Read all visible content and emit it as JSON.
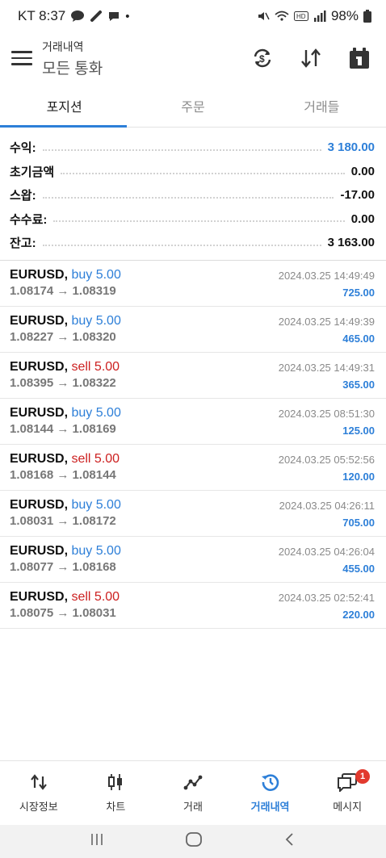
{
  "status_bar": {
    "carrier_time": "KT 8:37",
    "battery": "98%"
  },
  "header": {
    "title": "거래내역",
    "subtitle": "모든 통화"
  },
  "tabs": [
    {
      "label": "포지션",
      "active": true
    },
    {
      "label": "주문",
      "active": false
    },
    {
      "label": "거래들",
      "active": false
    }
  ],
  "summary": [
    {
      "label": "수익:",
      "value": "3 180.00"
    },
    {
      "label": "초기금액",
      "value": "0.00"
    },
    {
      "label": "스왑:",
      "value": "-17.00"
    },
    {
      "label": "수수료:",
      "value": "0.00"
    },
    {
      "label": "잔고:",
      "value": "3 163.00"
    }
  ],
  "trades": [
    {
      "symbol": "EURUSD,",
      "side": "buy 5.00",
      "type": "buy",
      "prices": "1.08174 → 1.08319",
      "time": "2024.03.25 14:49:49",
      "profit": "725.00"
    },
    {
      "symbol": "EURUSD,",
      "side": "buy 5.00",
      "type": "buy",
      "prices": "1.08227 → 1.08320",
      "time": "2024.03.25 14:49:39",
      "profit": "465.00"
    },
    {
      "symbol": "EURUSD,",
      "side": "sell 5.00",
      "type": "sell",
      "prices": "1.08395 → 1.08322",
      "time": "2024.03.25 14:49:31",
      "profit": "365.00"
    },
    {
      "symbol": "EURUSD,",
      "side": "buy 5.00",
      "type": "buy",
      "prices": "1.08144 → 1.08169",
      "time": "2024.03.25 08:51:30",
      "profit": "125.00"
    },
    {
      "symbol": "EURUSD,",
      "side": "sell 5.00",
      "type": "sell",
      "prices": "1.08168 → 1.08144",
      "time": "2024.03.25 05:52:56",
      "profit": "120.00"
    },
    {
      "symbol": "EURUSD,",
      "side": "buy 5.00",
      "type": "buy",
      "prices": "1.08031 → 1.08172",
      "time": "2024.03.25 04:26:11",
      "profit": "705.00"
    },
    {
      "symbol": "EURUSD,",
      "side": "buy 5.00",
      "type": "buy",
      "prices": "1.08077 → 1.08168",
      "time": "2024.03.25 04:26:04",
      "profit": "455.00"
    },
    {
      "symbol": "EURUSD,",
      "side": "sell 5.00",
      "type": "sell",
      "prices": "1.08075 → 1.08031",
      "time": "2024.03.25 02:52:41",
      "profit": "220.00"
    }
  ],
  "bottom_nav": [
    {
      "label": "시장정보",
      "icon": "quotes-icon",
      "active": false
    },
    {
      "label": "차트",
      "icon": "candlestick-icon",
      "active": false
    },
    {
      "label": "거래",
      "icon": "trade-line-icon",
      "active": false
    },
    {
      "label": "거래내역",
      "icon": "history-icon",
      "active": true
    },
    {
      "label": "메시지",
      "icon": "messages-icon",
      "active": false,
      "badge": "1"
    }
  ],
  "colors": {
    "accent": "#2d7fd8",
    "sell": "#cc1f1f",
    "badge": "#e23a2e"
  }
}
